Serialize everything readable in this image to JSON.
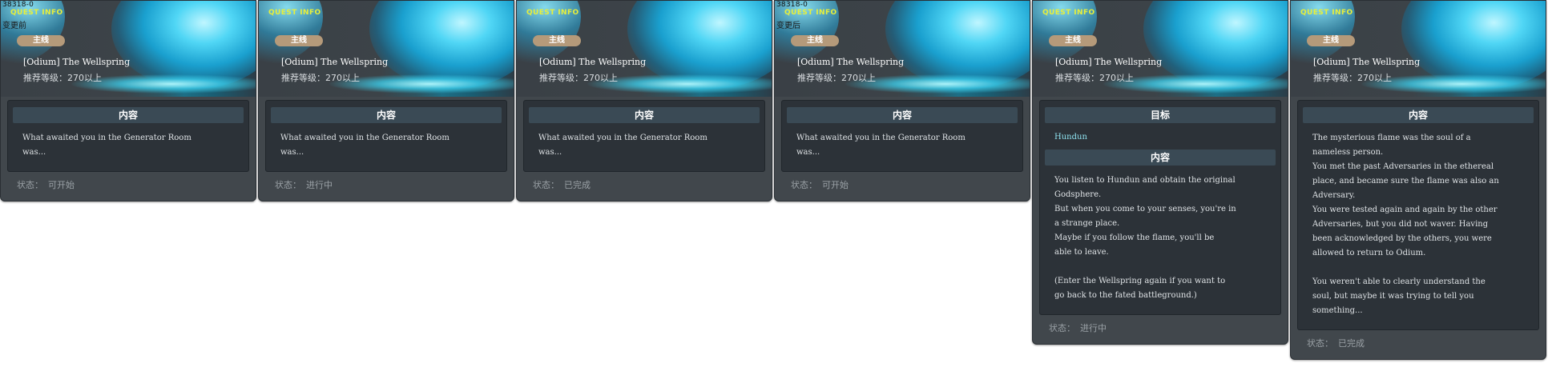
{
  "cards": [
    {
      "id_text": "38318-0",
      "header_tag": "QUEST INFO",
      "sub_label": "变更前",
      "badge": "主线",
      "title": "[Odium] The Wellspring",
      "level": "推荐等级：270以上",
      "sections": [
        {
          "heading": "内容",
          "text": "What awaited you in the Generator Room\nwas..."
        }
      ],
      "status_label": "状态：",
      "status_value": "可开始"
    },
    {
      "id_text": "",
      "header_tag": "QUEST INFO",
      "sub_label": "",
      "badge": "主线",
      "title": "[Odium] The Wellspring",
      "level": "推荐等级：270以上",
      "sections": [
        {
          "heading": "内容",
          "text": "What awaited you in the Generator Room\nwas..."
        }
      ],
      "status_label": "状态：",
      "status_value": "进行中"
    },
    {
      "id_text": "",
      "header_tag": "QUEST INFO",
      "sub_label": "",
      "badge": "主线",
      "title": "[Odium] The Wellspring",
      "level": "推荐等级：270以上",
      "sections": [
        {
          "heading": "内容",
          "text": "What awaited you in the Generator Room\nwas..."
        }
      ],
      "status_label": "状态：",
      "status_value": "已完成"
    },
    {
      "id_text": "38318-0",
      "header_tag": "QUEST INFO",
      "sub_label": "变更后",
      "badge": "主线",
      "title": "[Odium] The Wellspring",
      "level": "推荐等级：270以上",
      "sections": [
        {
          "heading": "内容",
          "text": "What awaited you in the Generator Room\nwas..."
        }
      ],
      "status_label": "状态：",
      "status_value": "可开始"
    },
    {
      "id_text": "",
      "header_tag": "QUEST INFO",
      "sub_label": "",
      "badge": "主线",
      "title": "[Odium] The Wellspring",
      "level": "推荐等级：270以上",
      "target": {
        "heading": "目标",
        "text": "Hundun"
      },
      "sections": [
        {
          "heading": "内容",
          "text": "You listen to Hundun and obtain the original\nGodsphere.\nBut when you come to your senses, you're in\na strange place.\nMaybe if you follow the flame, you'll be\nable to leave.\n\n(Enter the Wellspring again if you want to\ngo back to the fated battleground.)"
        }
      ],
      "status_label": "状态：",
      "status_value": "进行中"
    },
    {
      "id_text": "",
      "header_tag": "QUEST INFO",
      "sub_label": "",
      "badge": "主线",
      "title": "[Odium] The Wellspring",
      "level": "推荐等级：270以上",
      "sections": [
        {
          "heading": "内容",
          "text": "The mysterious flame was the soul of a\nnameless person.\nYou met the past Adversaries in the ethereal\nplace, and became sure the flame was also an\nAdversary.\nYou were tested again and again by the other\nAdversaries, but you did not waver. Having\nbeen acknowledged by the others, you were\nallowed to return to Odium.\n\nYou weren't able to clearly understand the\nsoul, but maybe it was trying to tell you\nsomething..."
        }
      ],
      "status_label": "状态：",
      "status_value": "已完成"
    }
  ]
}
